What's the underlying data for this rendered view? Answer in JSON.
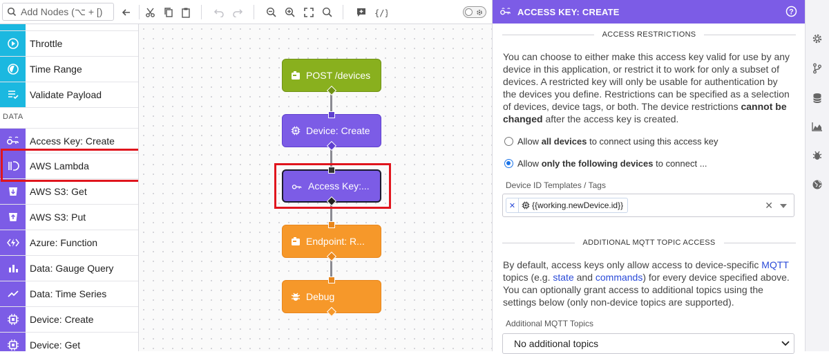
{
  "toolbar": {
    "search_placeholder": "Add Nodes (⌥ + [)"
  },
  "palette": {
    "section_data": "DATA",
    "items": [
      {
        "label": "Throttle",
        "icon": "throttle-icon",
        "color": "#1bb8e0"
      },
      {
        "label": "Time Range",
        "icon": "time-range-icon",
        "color": "#1bb8e0"
      },
      {
        "label": "Validate Payload",
        "icon": "validate-payload-icon",
        "color": "#1bb8e0"
      },
      {
        "label": "Access Key: Create",
        "icon": "access-key-icon",
        "color": "#7c5ce6"
      },
      {
        "label": "AWS Lambda",
        "icon": "aws-lambda-icon",
        "color": "#7c5ce6"
      },
      {
        "label": "AWS S3: Get",
        "icon": "aws-s3-icon",
        "color": "#7c5ce6"
      },
      {
        "label": "AWS S3: Put",
        "icon": "aws-s3-icon",
        "color": "#7c5ce6"
      },
      {
        "label": "Azure: Function",
        "icon": "azure-function-icon",
        "color": "#7c5ce6"
      },
      {
        "label": "Data: Gauge Query",
        "icon": "bar-chart-icon",
        "color": "#7c5ce6"
      },
      {
        "label": "Data: Time Series",
        "icon": "line-chart-icon",
        "color": "#7c5ce6"
      },
      {
        "label": "Device: Create",
        "icon": "chip-icon",
        "color": "#7c5ce6"
      },
      {
        "label": "Device: Get",
        "icon": "chip-icon",
        "color": "#7c5ce6"
      }
    ]
  },
  "canvas": {
    "nodes": [
      {
        "label": "POST /devices",
        "type": "trigger"
      },
      {
        "label": "Device: Create",
        "type": "data"
      },
      {
        "label": "Access Key:...",
        "type": "data",
        "selected": true
      },
      {
        "label": "Endpoint: R...",
        "type": "output"
      },
      {
        "label": "Debug",
        "type": "output"
      }
    ]
  },
  "panel": {
    "title": "ACCESS KEY: CREATE",
    "section_restrictions": "ACCESS RESTRICTIONS",
    "restrictions_text_1": "You can choose to either make this access key valid for use by any device in this application, or restrict it to work for only a subset of devices. A restricted key will only be usable for authentication by the devices you define. Restrictions can be specified as a selection of devices, device tags, or both. The device restrictions ",
    "restrictions_bold": "cannot be changed",
    "restrictions_text_2": " after the access key is created.",
    "radio_all_pre": "Allow ",
    "radio_all_bold": "all devices",
    "radio_all_post": " to connect using this access key",
    "radio_only_pre": "Allow ",
    "radio_only_bold": "only the following devices",
    "radio_only_post": " to connect ...",
    "selected_option": "only",
    "device_templates_label": "Device ID Templates / Tags",
    "device_tag_value": "{{working.newDevice.id}}",
    "section_mqtt": "ADDITIONAL MQTT TOPIC ACCESS",
    "mqtt_text_1": "By default, access keys only allow access to device-specific ",
    "mqtt_link_mqtt": "MQTT",
    "mqtt_text_2": " topics (e.g. ",
    "mqtt_link_state": "state",
    "mqtt_text_3": " and ",
    "mqtt_link_commands": "commands",
    "mqtt_text_4": ") for every device specified above. You can optionally grant access to additional topics using the settings below (only non-device topics are supported).",
    "mqtt_topics_label": "Additional MQTT Topics",
    "mqtt_topics_value": "No additional topics"
  },
  "colors": {
    "accent": "#7c5ce6",
    "trigger": "#89b01e",
    "output": "#f6982a",
    "logic": "#1bb8e0",
    "highlight": "#e0151d"
  }
}
